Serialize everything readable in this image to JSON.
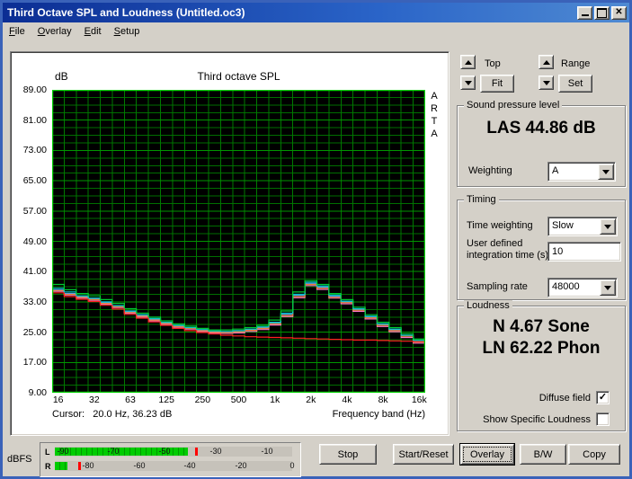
{
  "window": {
    "title": "Third Octave SPL and Loudness (Untitled.oc3)"
  },
  "menu": {
    "items": [
      {
        "label": "File"
      },
      {
        "label": "Overlay"
      },
      {
        "label": "Edit"
      },
      {
        "label": "Setup"
      }
    ]
  },
  "chart": {
    "watermark": "ARTA",
    "cursor_text": "Cursor:   20.0 Hz, 36.23 dB"
  },
  "chart_data": {
    "type": "step-line",
    "title": "Third octave SPL",
    "xlabel": "Frequency band (Hz)",
    "ylabel": "dB",
    "ylim": [
      9,
      89
    ],
    "y_tick_step": 8,
    "y_minor_step": 2,
    "y_tick_labels": [
      "89.00",
      "81.00",
      "73.00",
      "65.00",
      "57.00",
      "49.00",
      "41.00",
      "33.00",
      "25.00",
      "17.00",
      "9.00"
    ],
    "x_tick_labels": [
      "16",
      "32",
      "63",
      "125",
      "250",
      "500",
      "1k",
      "2k",
      "4k",
      "8k",
      "16k"
    ],
    "bands_hz": [
      16,
      20,
      25,
      31.5,
      40,
      50,
      63,
      80,
      100,
      125,
      160,
      200,
      250,
      315,
      400,
      500,
      630,
      800,
      1000,
      1250,
      1600,
      2000,
      2500,
      3150,
      4000,
      5000,
      6300,
      8000,
      10000,
      12500,
      16000
    ],
    "colors": {
      "background": "#000000",
      "grid_minor": "#006e00",
      "grid_major": "#009600",
      "grid_vertical": "#007a00",
      "frame": "#00d200"
    },
    "series": [
      {
        "name": "overlay-magenta",
        "color": "#ff78c8",
        "values": [
          35.8,
          34.8,
          34.0,
          33.4,
          32.4,
          31.5,
          30.0,
          29.0,
          28.0,
          27.1,
          26.3,
          25.8,
          25.2,
          24.8,
          24.7,
          24.8,
          25.2,
          25.7,
          26.9,
          29.1,
          34.1,
          37.3,
          36.3,
          34.0,
          32.5,
          30.5,
          28.5,
          26.5,
          25.1,
          23.6,
          22.1
        ]
      },
      {
        "name": "overlay-blue",
        "color": "#50a0ff",
        "values": [
          36.2,
          35.2,
          34.4,
          33.8,
          32.8,
          31.8,
          30.4,
          29.4,
          28.4,
          27.4,
          26.6,
          26.1,
          25.6,
          25.1,
          25.0,
          25.2,
          25.6,
          26.2,
          27.4,
          29.7,
          34.7,
          37.9,
          36.9,
          34.5,
          33.0,
          31.0,
          29.0,
          27.0,
          25.6,
          24.0,
          22.6
        ]
      },
      {
        "name": "overlay-orange",
        "color": "#e08030",
        "values": [
          36.0,
          35.0,
          34.2,
          33.6,
          32.6,
          31.7,
          30.2,
          29.2,
          28.2,
          27.3,
          26.5,
          26.0,
          25.4,
          25.0,
          24.9,
          25.1,
          25.5,
          26.0,
          27.2,
          29.4,
          34.4,
          37.6,
          36.6,
          34.2,
          32.8,
          30.8,
          28.8,
          26.8,
          25.4,
          23.9,
          22.4
        ]
      },
      {
        "name": "overlay-cyan",
        "color": "#00c8c8",
        "values": [
          36.6,
          35.6,
          34.6,
          34.0,
          33.0,
          32.0,
          30.6,
          29.6,
          28.6,
          27.6,
          26.8,
          26.2,
          25.7,
          25.3,
          25.2,
          25.4,
          25.8,
          26.4,
          27.6,
          30.0,
          35.0,
          38.2,
          37.2,
          34.8,
          33.2,
          31.2,
          29.2,
          27.2,
          25.8,
          24.2,
          22.8
        ]
      },
      {
        "name": "overlay-green",
        "color": "#00c832",
        "values": [
          37.6,
          36.2,
          35.2,
          34.6,
          33.6,
          32.6,
          31.2,
          30.0,
          29.0,
          28.0,
          27.2,
          26.6,
          26.0,
          25.6,
          25.6,
          25.8,
          26.2,
          26.8,
          28.2,
          30.6,
          35.6,
          38.6,
          37.6,
          35.2,
          33.6,
          31.6,
          29.6,
          27.6,
          26.2,
          24.6,
          23.2
        ]
      },
      {
        "name": "current-red",
        "color": "#ff2020",
        "values": [
          35.4,
          34.4,
          33.7,
          33.1,
          32.1,
          31.1,
          29.7,
          28.7,
          27.7,
          26.8,
          26.0,
          25.4,
          24.9,
          24.5,
          24.2,
          24.0,
          23.8,
          23.7,
          23.6,
          23.5,
          23.4,
          23.3,
          23.2,
          23.1,
          23.0,
          22.9,
          22.9,
          22.8,
          22.7,
          22.6,
          22.5
        ]
      }
    ]
  },
  "controls": {
    "top_label": "Top",
    "fit_label": "Fit",
    "range_label": "Range",
    "set_label": "Set"
  },
  "spl_group": {
    "title": "Sound pressure level",
    "value": "LAS 44.86 dB",
    "weighting_label": "Weighting",
    "weighting_value": "A"
  },
  "timing_group": {
    "title": "Timing",
    "time_weighting_label": "Time weighting",
    "time_weighting_value": "Slow",
    "integration_label": "User defined integration time (s)",
    "integration_value": "10",
    "sampling_label": "Sampling rate",
    "sampling_value": "48000"
  },
  "loudness_group": {
    "title": "Loudness",
    "n_value": "N 4.67 Sone",
    "ln_value": "LN 62.22 Phon",
    "diffuse_label": "Diffuse field",
    "diffuse_checked": true,
    "specific_label": "Show Specific Loudness",
    "specific_checked": false
  },
  "meter": {
    "unit_label": "dBFS",
    "range_db": [
      -93,
      0
    ],
    "bar_color": "#00cc00",
    "bar_color_dark": "#009900",
    "peak_color": "#ff0000",
    "rows": [
      {
        "channel": "L",
        "scale": [
          "-90",
          "-70",
          "-50",
          "-30",
          "-10"
        ],
        "level_db": -41,
        "peak_db": -38
      },
      {
        "channel": "R",
        "scale": [
          "-80",
          "-60",
          "-40",
          "-20",
          "0"
        ],
        "level_db": -88,
        "peak_db": -84
      }
    ]
  },
  "buttons": [
    {
      "label": "Stop"
    },
    {
      "label": "Start/Reset"
    },
    {
      "label": "Overlay",
      "default": true
    },
    {
      "label": "B/W"
    },
    {
      "label": "Copy"
    }
  ]
}
